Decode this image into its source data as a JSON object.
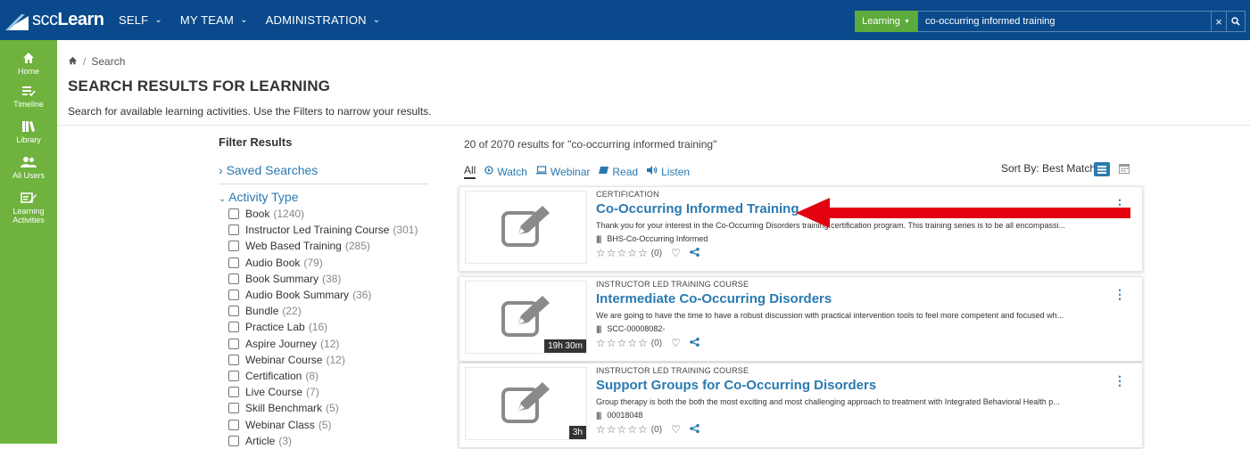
{
  "header": {
    "logo_prefix": "scc",
    "logo_suffix": "Learn",
    "nav": [
      {
        "label": "SELF"
      },
      {
        "label": "MY TEAM"
      },
      {
        "label": "ADMINISTRATION"
      }
    ],
    "search_scope": "Learning",
    "search_value": "co-occurring informed training",
    "clear_label": "×"
  },
  "sidebar": {
    "items": [
      {
        "label": "Home",
        "icon": "home-icon"
      },
      {
        "label": "Timeline",
        "icon": "timeline-icon"
      },
      {
        "label": "Library",
        "icon": "library-icon"
      },
      {
        "label": "All Users",
        "icon": "users-icon"
      },
      {
        "label": "Learning Activities",
        "label_1": "Learning",
        "label_2": "Activities",
        "icon": "learning-activities-icon"
      }
    ]
  },
  "breadcrumb": {
    "current": "Search"
  },
  "page": {
    "title": "SEARCH RESULTS FOR LEARNING",
    "subtitle": "Search for available learning activities. Use the Filters to narrow your results."
  },
  "filters": {
    "heading": "Filter Results",
    "saved_searches": "Saved Searches",
    "activity_type": "Activity Type",
    "items": [
      {
        "label": "Book",
        "count": "(1240)"
      },
      {
        "label": "Instructor Led Training Course",
        "count": "(301)"
      },
      {
        "label": "Web Based Training",
        "count": "(285)"
      },
      {
        "label": "Audio Book",
        "count": "(79)"
      },
      {
        "label": "Book Summary",
        "count": "(38)"
      },
      {
        "label": "Audio Book Summary",
        "count": "(36)"
      },
      {
        "label": "Bundle",
        "count": "(22)"
      },
      {
        "label": "Practice Lab",
        "count": "(16)"
      },
      {
        "label": "Aspire Journey",
        "count": "(12)"
      },
      {
        "label": "Webinar Course",
        "count": "(12)"
      },
      {
        "label": "Certification",
        "count": "(8)"
      },
      {
        "label": "Live Course",
        "count": "(7)"
      },
      {
        "label": "Skill Benchmark",
        "count": "(5)"
      },
      {
        "label": "Webinar Class",
        "count": "(5)"
      },
      {
        "label": "Article",
        "count": "(3)"
      }
    ]
  },
  "results": {
    "count_text": "20 of 2070 results for \"co-occurring informed training\"",
    "tabs": [
      {
        "label": "All",
        "icon": ""
      },
      {
        "label": "Watch",
        "icon": "play-circle-icon"
      },
      {
        "label": "Webinar",
        "icon": "monitor-icon"
      },
      {
        "label": "Read",
        "icon": "book-icon"
      },
      {
        "label": "Listen",
        "icon": "speaker-icon"
      }
    ],
    "sort_label": "Sort By: Best Match",
    "items": [
      {
        "type": "CERTIFICATION",
        "title": "Co-Occurring Informed Training",
        "description": "Thank you for your interest in the Co-Occurring Disorders training certification program. This training series is to be all encompassi...",
        "code": "BHS-Co-Occurring Informed",
        "duration": "",
        "stars": "☆☆☆☆☆",
        "rating": "(0)"
      },
      {
        "type": "INSTRUCTOR LED TRAINING COURSE",
        "title": "Intermediate Co-Occurring Disorders",
        "description": "We are going to have the time to have a robust discussion with practical intervention tools to feel more competent and focused wh...",
        "code": "SCC-00008082-",
        "duration": "19h 30m",
        "stars": "☆☆☆☆☆",
        "rating": "(0)"
      },
      {
        "type": "INSTRUCTOR LED TRAINING COURSE",
        "title": "Support Groups for Co-Occurring Disorders",
        "description": "Group therapy is both the both the most exciting and most challenging approach to treatment with Integrated Behavioral Health p...",
        "code": "00018048",
        "duration": "3h",
        "stars": "☆☆☆☆☆",
        "rating": "(0)"
      }
    ]
  },
  "colors": {
    "header": "#0a4a8c",
    "sidebar": "#6fb23e",
    "link": "#2a7ab0",
    "arrow": "#e3000f"
  }
}
